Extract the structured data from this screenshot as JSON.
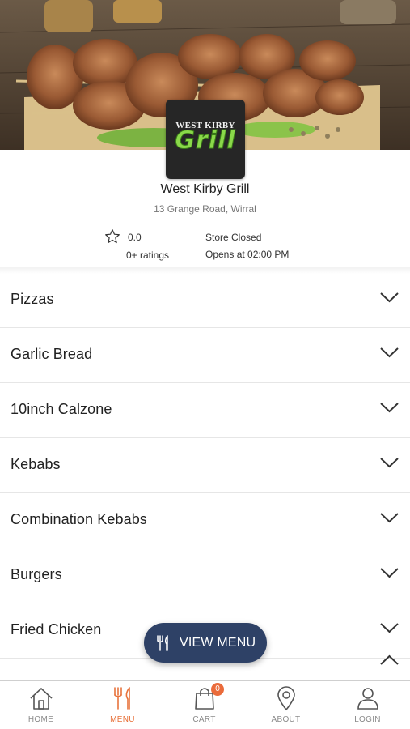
{
  "store": {
    "name": "West Kirby Grill",
    "address": "13 Grange Road, Wirral",
    "logo_top": "WEST KIRBY",
    "logo_main": "Grill",
    "rating": "0.0",
    "rating_count": "0+ ratings",
    "status": "Store Closed",
    "opens": "Opens at 02:00 PM"
  },
  "categories": [
    "Pizzas",
    "Garlic Bread",
    "10inch Calzone",
    "Kebabs",
    "Combination Kebabs",
    "Burgers",
    "Fried Chicken"
  ],
  "view_menu_label": "VIEW MENU",
  "nav": {
    "items": [
      {
        "label": "HOME",
        "icon": "home-icon"
      },
      {
        "label": "MENU",
        "icon": "cutlery-icon"
      },
      {
        "label": "CART",
        "icon": "shopping-bag-icon"
      },
      {
        "label": "ABOUT",
        "icon": "location-pin-icon"
      },
      {
        "label": "LOGIN",
        "icon": "user-icon"
      }
    ],
    "active": "MENU",
    "cart_count": "0"
  },
  "colors": {
    "accent": "#e8733c",
    "button": "#2e4166",
    "badge": "#ea6b3b",
    "logo_green": "#8ad84a"
  }
}
